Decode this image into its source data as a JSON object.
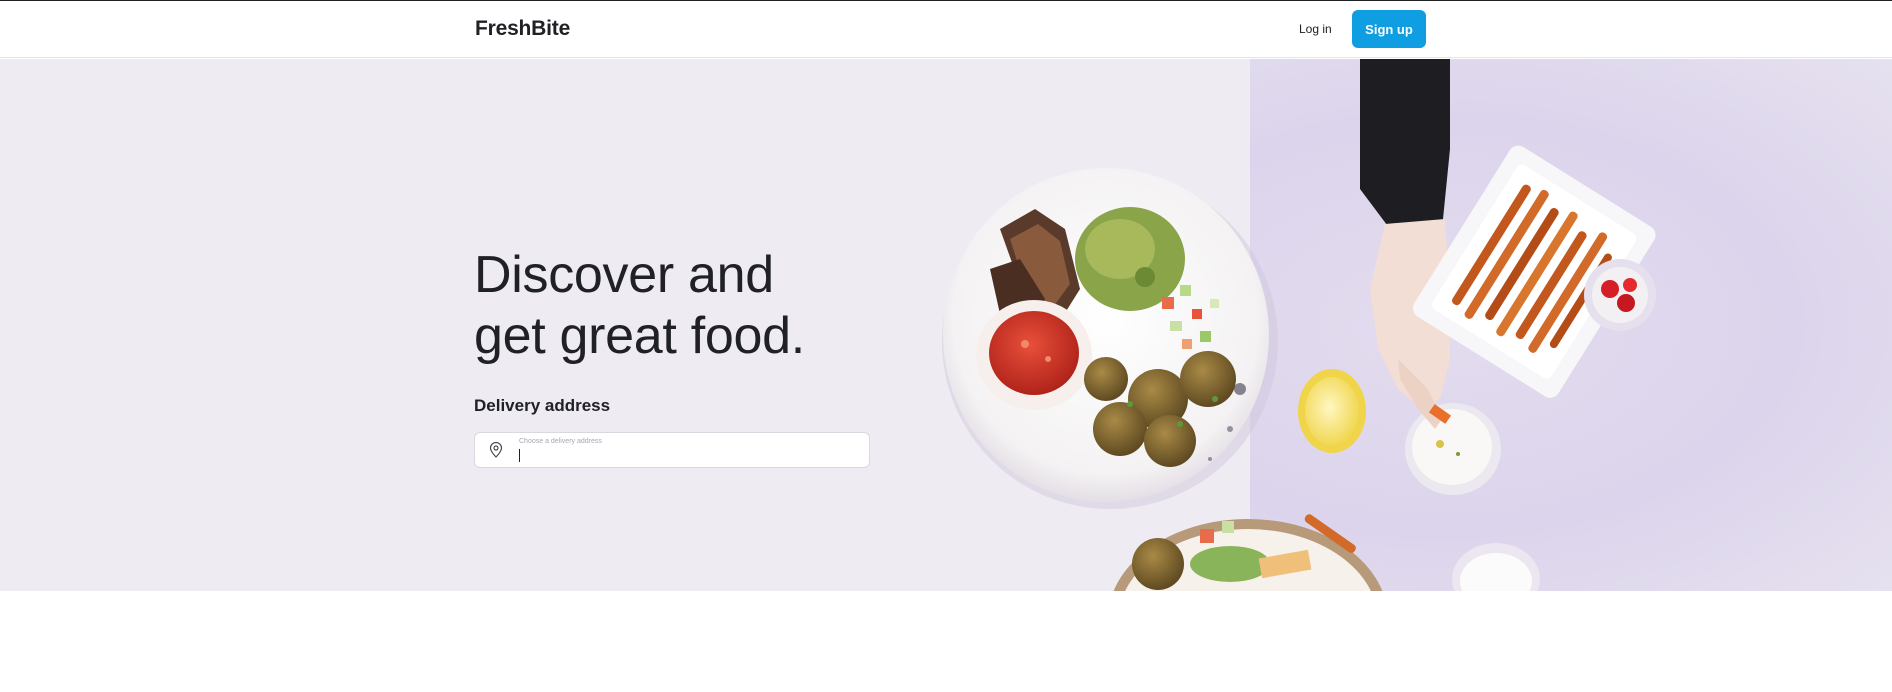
{
  "header": {
    "logo": "FreshBite",
    "login_label": "Log in",
    "signup_label": "Sign up"
  },
  "hero": {
    "title_line1": "Discover and",
    "title_line2": "get great food.",
    "address_label": "Delivery address",
    "address_placeholder": "Choose a delivery address",
    "address_value": ""
  },
  "colors": {
    "accent": "#109ee2",
    "hero_bg": "#eeebf2",
    "text": "#202125"
  },
  "icons": {
    "address_icon": "location-pin-icon"
  }
}
